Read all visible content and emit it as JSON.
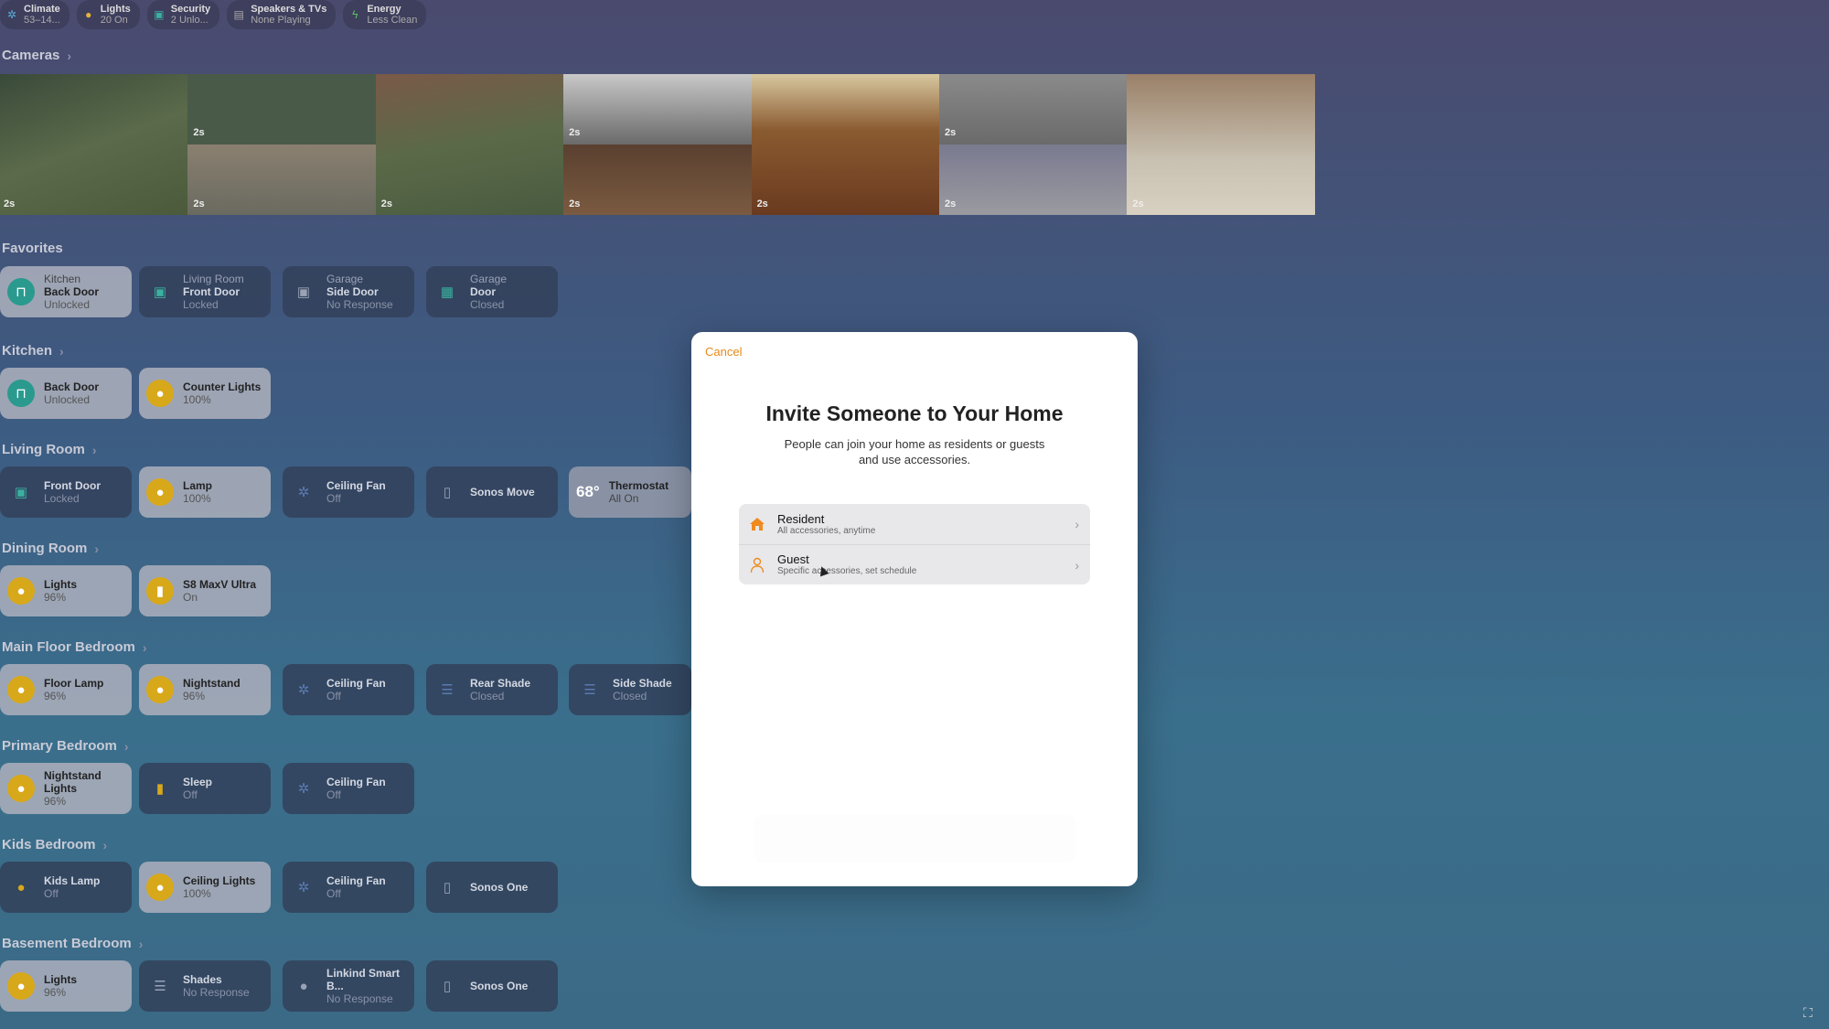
{
  "topbar": [
    {
      "icon": "fan-icon",
      "label": "Climate",
      "sub": "53–14..."
    },
    {
      "icon": "bulb-icon",
      "label": "Lights",
      "sub": "20 On"
    },
    {
      "icon": "lock-icon",
      "label": "Security",
      "sub": "2 Unlo..."
    },
    {
      "icon": "speaker-icon",
      "label": "Speakers & TVs",
      "sub": "None Playing"
    },
    {
      "icon": "bolt-icon",
      "label": "Energy",
      "sub": "Less Clean"
    }
  ],
  "sections": {
    "cameras": "Cameras",
    "favorites": "Favorites",
    "kitchen": "Kitchen",
    "living_room": "Living Room",
    "dining_room": "Dining Room",
    "main_floor_bedroom": "Main Floor Bedroom",
    "primary_bedroom": "Primary Bedroom",
    "kids_bedroom": "Kids Bedroom",
    "basement_bedroom": "Basement Bedroom"
  },
  "cameras": {
    "labels": [
      "2s",
      "2s",
      "2s",
      "2s",
      "2s",
      "2s",
      "2s",
      "2s",
      "2s",
      "2s",
      "2s"
    ]
  },
  "favorites": [
    {
      "room": "Kitchen",
      "name": "Back Door",
      "state": "Unlocked",
      "on": true
    },
    {
      "room": "Living Room",
      "name": "Front Door",
      "state": "Locked",
      "on": false
    },
    {
      "room": "Garage",
      "name": "Side Door",
      "state": "No Response",
      "on": false
    },
    {
      "room": "Garage",
      "name": "Door",
      "state": "Closed",
      "on": false
    }
  ],
  "kitchen": [
    {
      "name": "Back Door",
      "state": "Unlocked"
    },
    {
      "name": "Counter Lights",
      "state": "100%"
    }
  ],
  "living_room": [
    {
      "name": "Front Door",
      "state": "Locked"
    },
    {
      "name": "Lamp",
      "state": "100%"
    },
    {
      "name": "Ceiling Fan",
      "state": "Off"
    },
    {
      "name": "Sonos Move",
      "state": ""
    },
    {
      "temp": "68°",
      "name": "Thermostat",
      "state": "All On"
    }
  ],
  "dining_room": [
    {
      "name": "Lights",
      "state": "96%"
    },
    {
      "name": "S8 MaxV Ultra",
      "state": "On"
    }
  ],
  "main_floor_bedroom": [
    {
      "name": "Floor Lamp",
      "state": "96%"
    },
    {
      "name": "Nightstand",
      "state": "96%"
    },
    {
      "name": "Ceiling Fan",
      "state": "Off"
    },
    {
      "name": "Rear Shade",
      "state": "Closed"
    },
    {
      "name": "Side Shade",
      "state": "Closed"
    }
  ],
  "primary_bedroom": [
    {
      "name": "Nightstand Lights",
      "state": "96%"
    },
    {
      "name": "Sleep",
      "state": "Off"
    },
    {
      "name": "Ceiling Fan",
      "state": "Off"
    }
  ],
  "kids_bedroom": [
    {
      "name": "Kids Lamp",
      "state": "Off"
    },
    {
      "name": "Ceiling Lights",
      "state": "100%"
    },
    {
      "name": "Ceiling Fan",
      "state": "Off"
    },
    {
      "name": "Sonos One",
      "state": ""
    }
  ],
  "basement_bedroom": [
    {
      "name": "Lights",
      "state": "96%"
    },
    {
      "name": "Shades",
      "state": "No Response"
    },
    {
      "name": "Linkind Smart B...",
      "state": "No Response"
    },
    {
      "name": "Sonos One",
      "state": ""
    }
  ],
  "modal": {
    "cancel": "Cancel",
    "title": "Invite Someone to Your Home",
    "subtitle": "People can join your home as residents or guests and use accessories.",
    "options": [
      {
        "label": "Resident",
        "desc": "All accessories, anytime"
      },
      {
        "label": "Guest",
        "desc": "Specific accessories, set schedule"
      }
    ]
  },
  "colors": {
    "accent": "#e58a1a",
    "teal": "#2a9a8e",
    "yellow": "#d8a81b"
  }
}
